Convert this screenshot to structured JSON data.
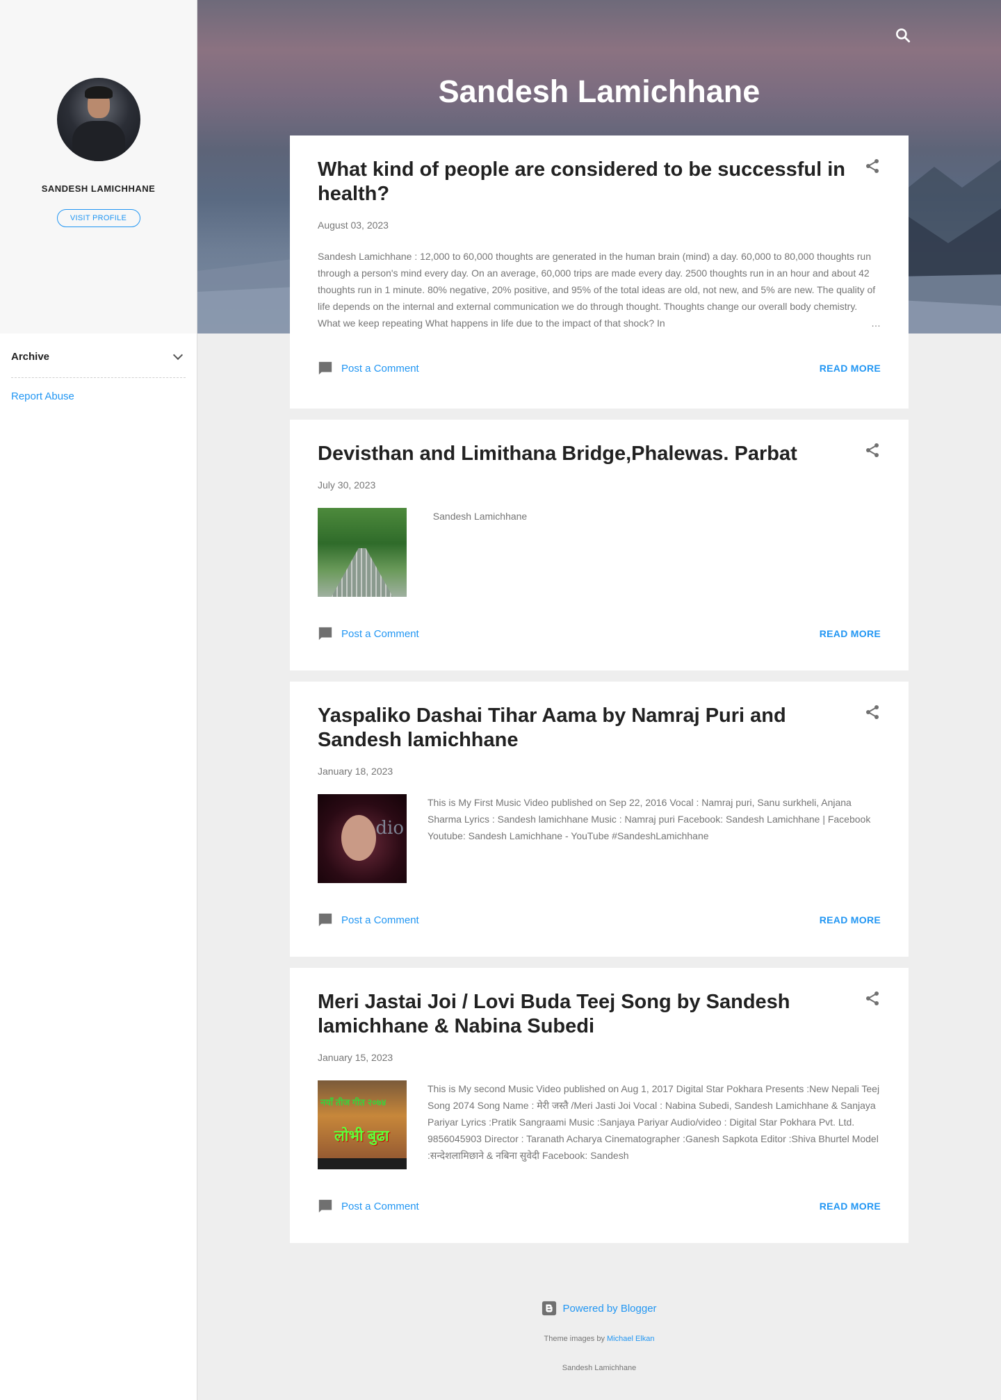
{
  "sidebar": {
    "profile_name": "SANDESH LAMICHHANE",
    "visit_profile": "VISIT PROFILE",
    "archive_title": "Archive",
    "report_abuse": "Report Abuse"
  },
  "header": {
    "blog_title": "Sandesh Lamichhane"
  },
  "posts": [
    {
      "title": "What kind of people are considered to be successful in health?",
      "date": "August 03, 2023",
      "snippet": " Sandesh Lamichhane :   12,000 to 60,000 thoughts are generated in the human brain (mind) a day.  60,000 to 80,000 thoughts run through a person's mind every day.  On an average, 60,000 trips are made every day.  2500 thoughts run in an hour and about 42 thoughts run in 1 minute.  80% negative, 20% positive, and 95% of the total ideas are old, not new, and 5% are new. The quality of life depends on the internal and external communication we do through thought.  Thoughts change our overall body chemistry.  What we  keep  repeating  What happens in life due to the impact of that shock?  In",
      "ellipsis": "…",
      "comment_label": "Post a Comment",
      "read_more": "READ MORE"
    },
    {
      "title": "Devisthan and Limithana Bridge,Phalewas. Parbat",
      "date": "July 30, 2023",
      "snippet": "  Sandesh Lamichhane",
      "comment_label": "Post a Comment",
      "read_more": "READ MORE"
    },
    {
      "title": "Yaspaliko Dashai Tihar Aama by Namraj Puri and Sandesh lamichhane",
      "date": "January 18, 2023",
      "snippet": "  This is My First Music Video published on Sep 22, 2016 Vocal : Namraj puri, Sanu surkheli, Anjana Sharma Lyrics : Sandesh lamichhane Music : Namraj puri Facebook: Sandesh Lamichhane | Facebook Youtube:  Sandesh Lamichhane - YouTube #SandeshLamichhane",
      "thumb_text": "dio",
      "comment_label": "Post a Comment",
      "read_more": "READ MORE"
    },
    {
      "title": "Meri Jastai Joi / Lovi Buda Teej Song by Sandesh lamichhane & Nabina Subedi",
      "date": "January 15, 2023",
      "snippet": "This is My second Music Video published on Aug 1, 2017 Digital Star Pokhara Presents :New Nepali Teej Song 2074 Song Name : मेरी जस्तै /Meri Jasti Joi Vocal : Nabina Subedi, Sandesh Lamichhane & Sanjaya Pariyar Lyrics :Pratik Sangraami Music :Sanjaya Pariyar Audio/video : Digital Star Pokhara Pvt. Ltd. 9856045903 Director : Taranath Acharya Cinematographer :Ganesh Sapkota Editor :Shiva Bhurtel Model :सन्देशलामिछाने & नबिना सुवेदी Facebook: Sandesh",
      "thumb_text_top": "नयाँ तीज गीत २०७४",
      "thumb_text_main": "लोभी बुढा",
      "comment_label": "Post a Comment",
      "read_more": "READ MORE"
    }
  ],
  "footer": {
    "powered_by": "Powered by Blogger",
    "theme_prefix": "Theme images by ",
    "theme_author": "Michael Elkan",
    "site_name": "Sandesh Lamichhane"
  },
  "colors": {
    "accent": "#2196f3",
    "text": "#212121",
    "muted": "#757575",
    "background": "#eeeeee"
  },
  "icons": [
    "search-icon",
    "share-icon",
    "comment-icon",
    "chevron-down-icon",
    "blogger-icon"
  ]
}
